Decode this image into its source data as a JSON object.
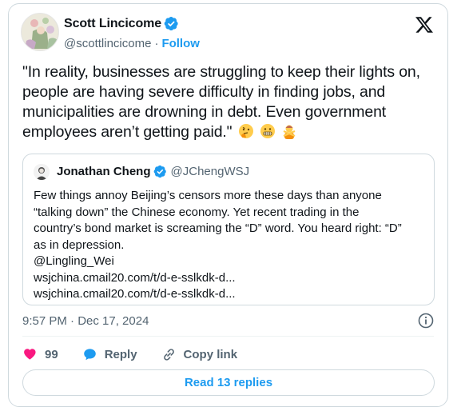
{
  "author": {
    "name": "Scott Lincicome",
    "handle": "@scottlincicome",
    "follow_label": "Follow",
    "separator": "·"
  },
  "tweet": {
    "text": "\"In reality, businesses are struggling to keep their lights on, people are having severe difficulty in finding jobs, and municipalities are drowning in debt. Even government employees aren’t getting paid.\"",
    "emojis": [
      "thinking-face",
      "grimacing-face",
      "person-gesturing-no"
    ]
  },
  "quote": {
    "name": "Jonathan Cheng",
    "handle": "@JChengWSJ",
    "lines": [
      "Few things annoy Beijing’s censors more these days than anyone",
      "“talking down” the Chinese economy. Yet recent trading in the",
      "country’s bond market is screaming the “D” word. You heard right: “D”",
      "as in depression.",
      "@Lingling_Wei",
      "wsjchina.cmail20.com/t/d-e-sslkdk-d...",
      "wsjchina.cmail20.com/t/d-e-sslkdk-d..."
    ]
  },
  "meta": {
    "timestamp": "9:57 PM · Dec 17, 2024"
  },
  "actions": {
    "like_count": "99",
    "reply_label": "Reply",
    "copy_link_label": "Copy link"
  },
  "read_replies_label": "Read 13 replies",
  "colors": {
    "accent": "#1d9bf0",
    "like": "#f91880",
    "text": "#0f1419",
    "muted": "#536471",
    "border": "#cfd9de"
  }
}
